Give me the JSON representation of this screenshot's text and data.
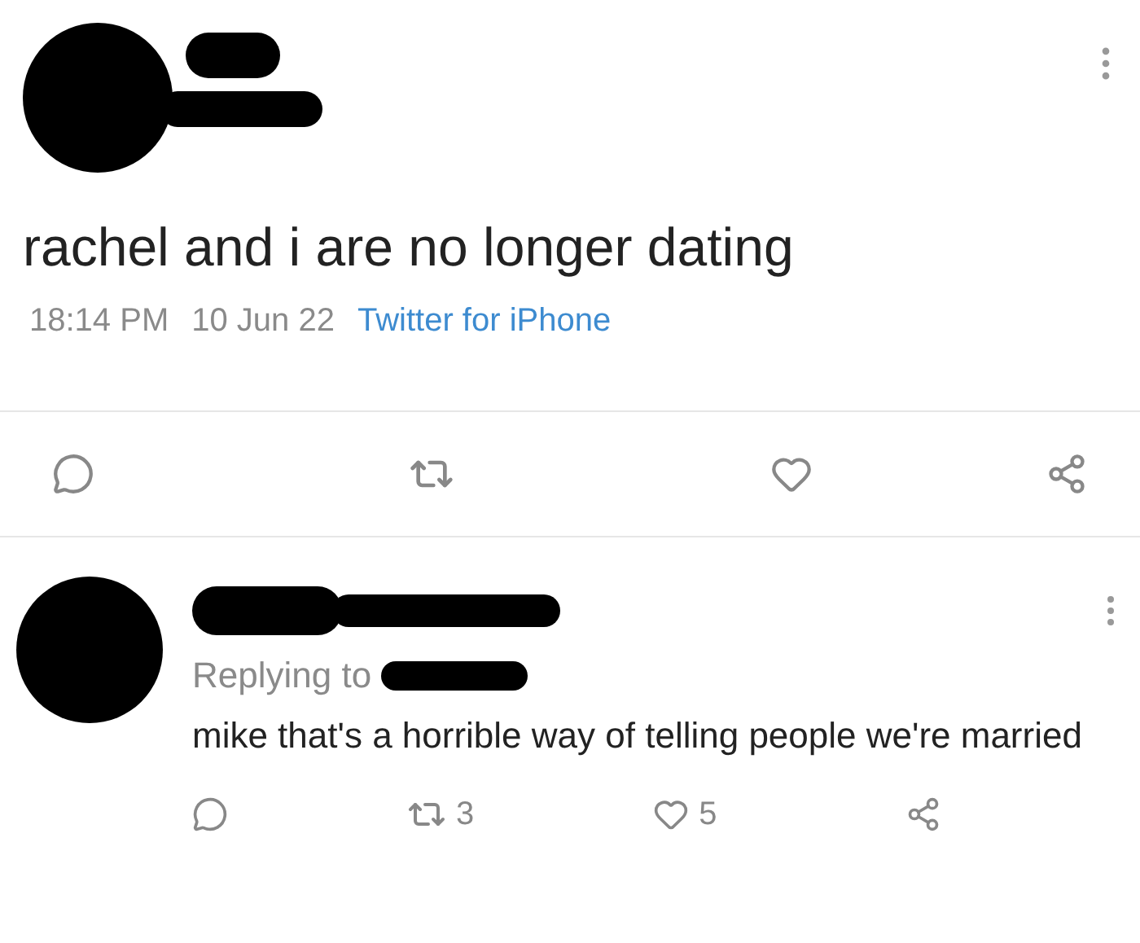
{
  "tweet": {
    "text": "rachel and i are no longer dating",
    "time": "18:14 PM",
    "date": "10 Jun 22",
    "source": "Twitter for iPhone"
  },
  "reply": {
    "replying_to": "Replying to",
    "text": "mike that's a horrible way of telling people we're married",
    "retweets": "3",
    "likes": "5"
  }
}
